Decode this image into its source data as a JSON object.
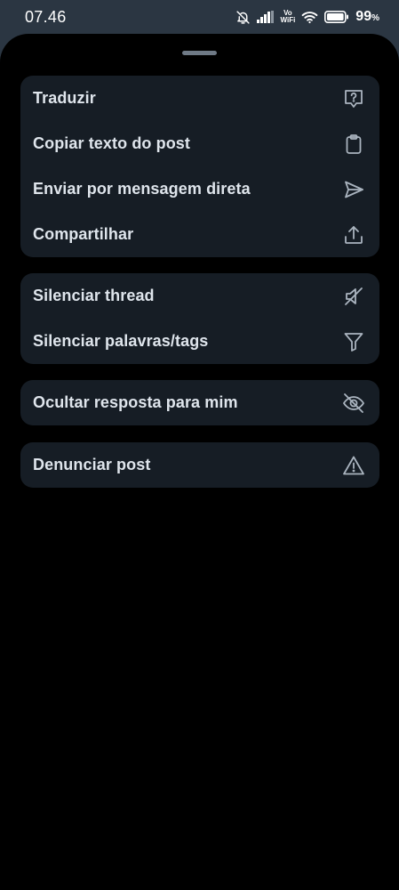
{
  "status_bar": {
    "time": "07.46",
    "volte_top": "Vo",
    "volte_bottom": "WiFi",
    "battery": "99",
    "battery_unit": "%",
    "icons": [
      "bell-muted-icon",
      "signal-icon",
      "vowifi-icon",
      "wifi-icon",
      "battery-icon"
    ]
  },
  "menu": {
    "groups": [
      {
        "items": [
          {
            "label": "Traduzir",
            "icon": "translate-icon"
          },
          {
            "label": "Copiar texto do post",
            "icon": "clipboard-icon"
          },
          {
            "label": "Enviar por mensagem direta",
            "icon": "send-icon"
          },
          {
            "label": "Compartilhar",
            "icon": "share-icon"
          }
        ]
      },
      {
        "items": [
          {
            "label": "Silenciar thread",
            "icon": "mute-thread-icon"
          },
          {
            "label": "Silenciar palavras/tags",
            "icon": "filter-icon"
          }
        ]
      },
      {
        "items": [
          {
            "label": "Ocultar resposta para mim",
            "icon": "eye-slash-icon"
          }
        ]
      },
      {
        "items": [
          {
            "label": "Denunciar post",
            "icon": "warning-icon"
          }
        ]
      }
    ]
  },
  "colors": {
    "background_top": "#2b3642",
    "sheet": "#000000",
    "group": "#161d25",
    "text": "#dfe5ec",
    "icon": "#aab4bf",
    "handle": "#6f7a86"
  }
}
